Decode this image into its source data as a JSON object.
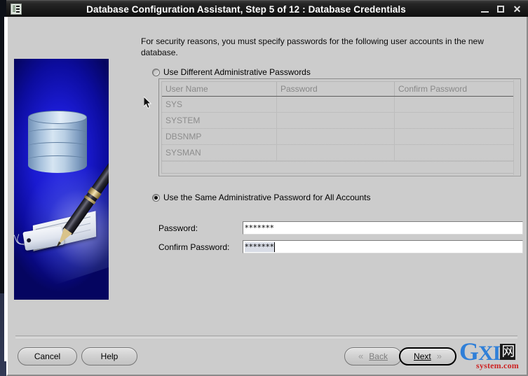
{
  "window": {
    "title": "Database Configuration Assistant, Step 5 of 12 : Database Credentials",
    "icon": "database-wizard-icon",
    "controls": {
      "minimize": "_",
      "maximize": "□",
      "close": "✕"
    }
  },
  "banner": {
    "alt": "database-cylinder-and-pen-illustration"
  },
  "main": {
    "intro": "For security reasons, you must specify passwords for the following user accounts in the new database.",
    "options": [
      {
        "id": "different",
        "label": "Use Different Administrative Passwords",
        "selected": false
      },
      {
        "id": "same",
        "label": "Use the Same Administrative Password for All Accounts",
        "selected": true
      }
    ],
    "credentials_table": {
      "columns": [
        "User Name",
        "Password",
        "Confirm Password"
      ],
      "rows": [
        {
          "user_name": "SYS",
          "password": "",
          "confirm_password": ""
        },
        {
          "user_name": "SYSTEM",
          "password": "",
          "confirm_password": ""
        },
        {
          "user_name": "DBSNMP",
          "password": "",
          "confirm_password": ""
        },
        {
          "user_name": "SYSMAN",
          "password": "",
          "confirm_password": ""
        }
      ],
      "enabled": false
    },
    "fields": [
      {
        "id": "password",
        "label": "Password:",
        "value": "*******",
        "placeholder": ""
      },
      {
        "id": "confirm_password",
        "label": "Confirm Password:",
        "value": "*******",
        "placeholder": ""
      }
    ]
  },
  "footer": {
    "buttons": [
      {
        "id": "cancel",
        "label": "Cancel",
        "mnemonic": "",
        "enabled": true
      },
      {
        "id": "help",
        "label": "Help",
        "mnemonic": "",
        "enabled": true
      },
      {
        "id": "back",
        "label": "Back",
        "mnemonic": "B",
        "chevron": "«",
        "enabled": false
      },
      {
        "id": "next",
        "label": "Next",
        "mnemonic": "N",
        "chevron": "»",
        "enabled": true,
        "focused": true
      }
    ]
  },
  "watermark": {
    "prefix": "G",
    "text": "XI",
    "cjk": "网",
    "subtitle": "system.com",
    "color_primary": "#2f7fd8",
    "color_subtitle": "#cc2222"
  },
  "colors": {
    "window_bg": "#cccccc",
    "titlebar": "#1a1a1a",
    "banner_blue": "#1a1ad0",
    "input_bg": "#ffffff",
    "disabled_text": "#8d8d8d"
  }
}
